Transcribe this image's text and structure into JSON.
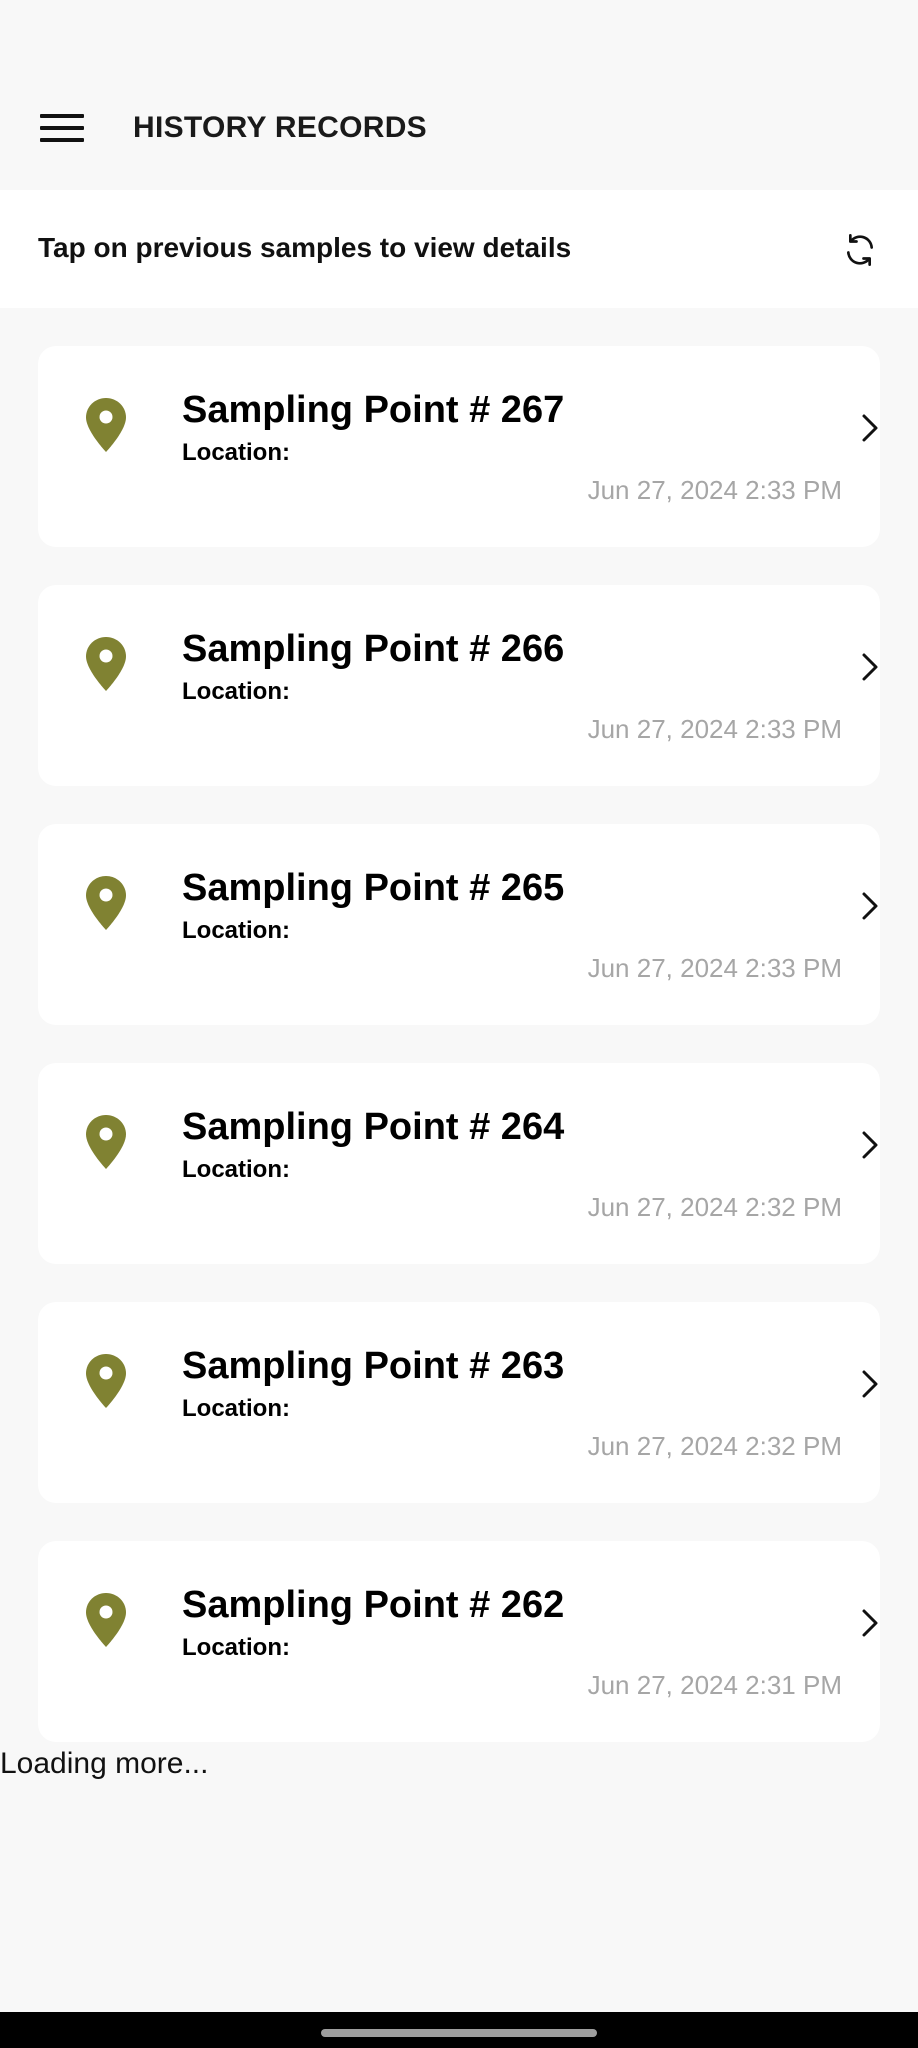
{
  "app_bar": {
    "title": "HISTORY RECORDS",
    "menu_icon": "hamburger-menu-icon"
  },
  "subheader": {
    "text": "Tap on previous samples to view details",
    "refresh_icon": "refresh-icon"
  },
  "colors": {
    "accent": "#808232",
    "date_text": "#a6a6a6",
    "card_background": "#ffffff",
    "page_background": "#f8f8f8"
  },
  "records": [
    {
      "title": "Sampling Point # 267",
      "location_label": "Location:",
      "date": "Jun 27, 2024 2:33 PM"
    },
    {
      "title": "Sampling Point # 266",
      "location_label": "Location:",
      "date": "Jun 27, 2024 2:33 PM"
    },
    {
      "title": "Sampling Point # 265",
      "location_label": "Location:",
      "date": "Jun 27, 2024 2:33 PM"
    },
    {
      "title": "Sampling Point # 264",
      "location_label": "Location:",
      "date": "Jun 27, 2024 2:32 PM"
    },
    {
      "title": "Sampling Point # 263",
      "location_label": "Location:",
      "date": "Jun 27, 2024 2:32 PM"
    },
    {
      "title": "Sampling Point # 262",
      "location_label": "Location:",
      "date": "Jun 27, 2024 2:31 PM"
    }
  ],
  "footer": {
    "loading_text": "Loading more..."
  }
}
